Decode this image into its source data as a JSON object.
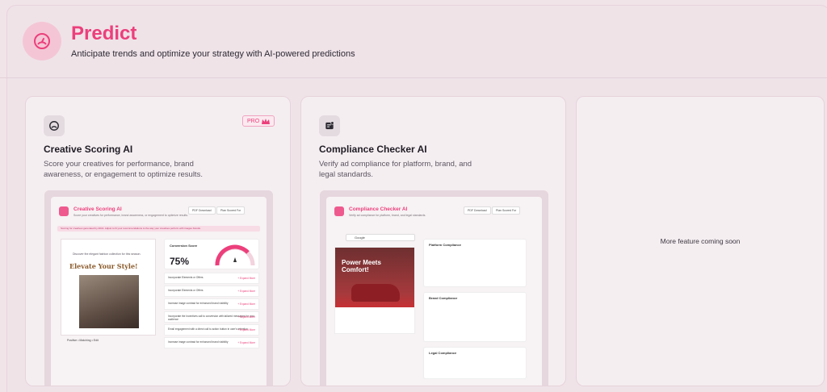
{
  "header": {
    "title": "Predict",
    "subtitle": "Anticipate trends and optimize your strategy with AI-powered predictions",
    "icon": "gauge-icon"
  },
  "colors": {
    "accent": "#ec3f7b",
    "background": "#efe3e8",
    "card": "#f5eef1"
  },
  "cards": [
    {
      "title": "Creative Scoring AI",
      "description": "Score your creatives for performance, brand awareness, or engagement to optimize results.",
      "icon": "gauge-icon",
      "badge": "PRO",
      "preview": {
        "title": "Creative Scoring AI",
        "subtitle": "Score your creatives for performance, brand awareness, or engagement to optimize results.",
        "btn1": "PDF Download",
        "btn2": "Plan Scored For",
        "notice": "Scoring for creatives generated by AIDA. Adjust to fit your recommendations to the way your creatives perform with images brands.",
        "ad_headline": "Elevate Your Style!",
        "ad_tag": "Discover the elegant fashion collection for this season.",
        "score_label": "Conversion Score",
        "score_value": "75%",
        "recommendations": [
          "Incorporate Elements or Offers",
          "Incorporate Elements or Offers",
          "Increase image contrast for enhanced brand visibility",
          "Incorporate the Incentives call to conversion with tailored messages for your audience",
          "Email engagement with a direct call to action button in user's retention",
          "Increase image contrast for enhanced brand visibility"
        ],
        "rec_link": "+ Expand More",
        "footer": "Positive • Matching • Edit"
      }
    },
    {
      "title": "Compliance Checker AI",
      "description": "Verify ad compliance for platform, brand, and legal standards.",
      "icon": "compliance-icon",
      "preview": {
        "title": "Compliance Checker AI",
        "subtitle": "Verify ad compliance for platform, brand, and legal standards.",
        "btn1": "PDF Download",
        "btn2": "Plan Scored For",
        "platform": "Google",
        "ad_headline": "Power Meets Comfort!",
        "sections": [
          "Platform Compliance",
          "Brand Compliance",
          "Legal Compliance"
        ]
      }
    },
    {
      "placeholder": "More feature coming soon"
    }
  ]
}
